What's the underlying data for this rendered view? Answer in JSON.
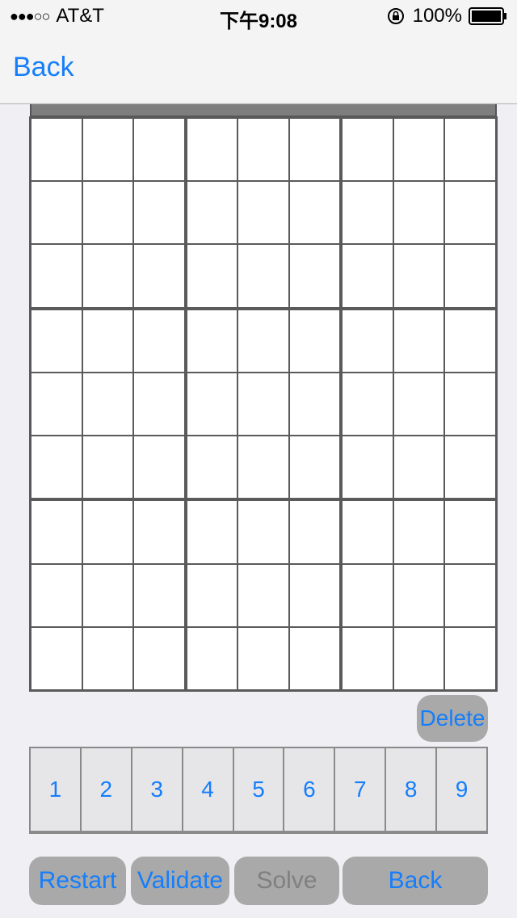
{
  "status_bar": {
    "signal": "●●●○○",
    "carrier": "AT&T",
    "time": "下午9:08",
    "battery_percent": "100%"
  },
  "nav": {
    "back_label": "Back"
  },
  "board": {
    "cells": [
      [
        "",
        "",
        "",
        "",
        "",
        "",
        "",
        "",
        ""
      ],
      [
        "",
        "",
        "",
        "",
        "",
        "",
        "",
        "",
        ""
      ],
      [
        "",
        "",
        "",
        "",
        "",
        "",
        "",
        "",
        ""
      ],
      [
        "",
        "",
        "",
        "",
        "",
        "",
        "",
        "",
        ""
      ],
      [
        "",
        "",
        "",
        "",
        "",
        "",
        "",
        "",
        ""
      ],
      [
        "",
        "",
        "",
        "",
        "",
        "",
        "",
        "",
        ""
      ],
      [
        "",
        "",
        "",
        "",
        "",
        "",
        "",
        "",
        ""
      ],
      [
        "",
        "",
        "",
        "",
        "",
        "",
        "",
        "",
        ""
      ],
      [
        "",
        "",
        "",
        "",
        "",
        "",
        "",
        "",
        ""
      ]
    ]
  },
  "delete_label": "Delete",
  "numpad": [
    "1",
    "2",
    "3",
    "4",
    "5",
    "6",
    "7",
    "8",
    "9"
  ],
  "buttons": {
    "restart": "Restart",
    "validate": "Validate",
    "solve": "Solve",
    "back": "Back"
  },
  "colors": {
    "accent": "#157efb",
    "disabled": "#808080",
    "button_bg": "#a9a9a9"
  }
}
